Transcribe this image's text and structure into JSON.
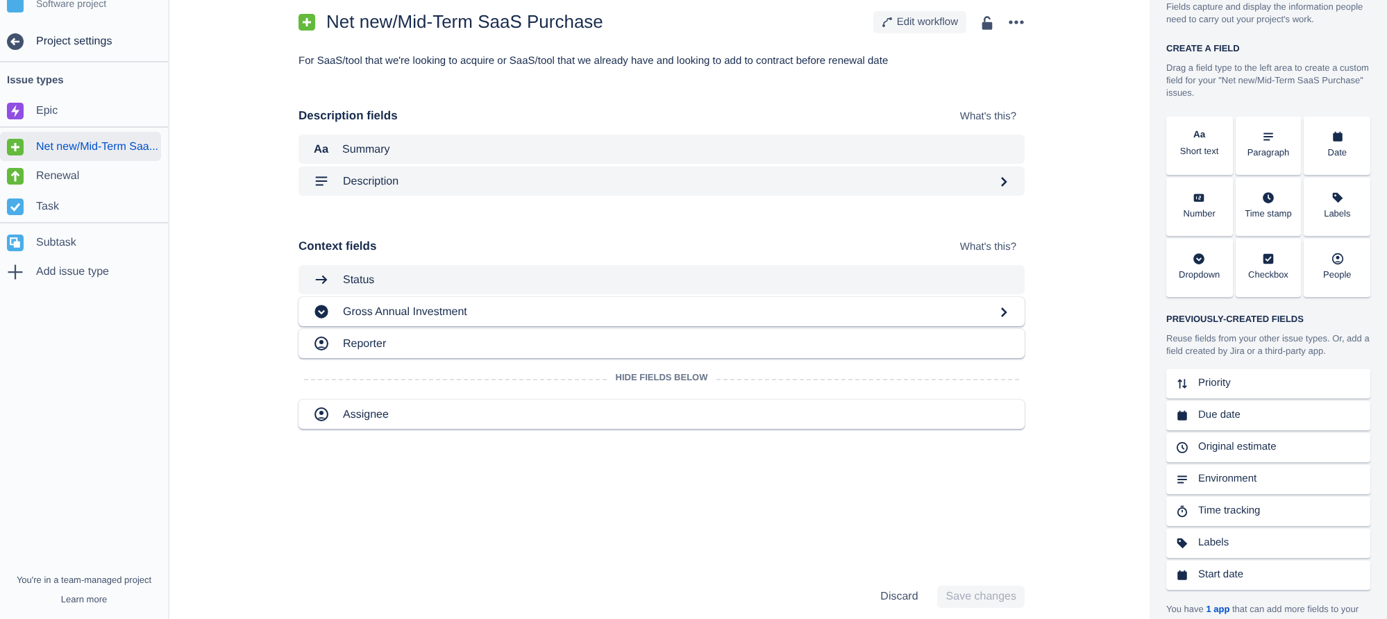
{
  "sidebar": {
    "project_type": "Software project",
    "settings_link": "Project settings",
    "section_title": "Issue types",
    "issue_types": [
      {
        "label": "Epic",
        "kind": "epic",
        "color": "#904ee2",
        "selected": false,
        "divider_after": true
      },
      {
        "label": "Net new/Mid-Term Saa...",
        "kind": "plus",
        "color": "#63ba3c",
        "selected": true,
        "divider_after": false
      },
      {
        "label": "Renewal",
        "kind": "up",
        "color": "#63ba3c",
        "selected": false,
        "divider_after": false
      },
      {
        "label": "Task",
        "kind": "check",
        "color": "#4bade8",
        "selected": false,
        "divider_after": true
      },
      {
        "label": "Subtask",
        "kind": "subtask",
        "color": "#4bade8",
        "selected": false,
        "divider_after": false
      }
    ],
    "add_label": "Add issue type",
    "footer_text": "You're in a team-managed project",
    "footer_link": "Learn more"
  },
  "main": {
    "title": "Net new/Mid-Term SaaS Purchase",
    "edit_workflow": "Edit workflow",
    "description": "For SaaS/tool that we're looking to acquire or SaaS/tool that we already have and looking to add to contract before renewal date",
    "sections": [
      {
        "title": "Description fields",
        "help": "What's this?",
        "fields": [
          {
            "label": "Summary",
            "kind": "text",
            "icon_text": "Aa",
            "locked": true,
            "chevron": false
          },
          {
            "label": "Description",
            "kind": "paragraph",
            "locked": true,
            "chevron": true
          }
        ]
      },
      {
        "title": "Context fields",
        "help": "What's this?",
        "fields": [
          {
            "label": "Status",
            "kind": "arrow",
            "locked": true,
            "chevron": false
          },
          {
            "label": "Gross Annual Investment",
            "kind": "dropdown",
            "locked": false,
            "chevron": true
          },
          {
            "label": "Reporter",
            "kind": "person",
            "locked": false,
            "chevron": false
          }
        ],
        "hide_label": "HIDE FIELDS BELOW",
        "hidden_fields": [
          {
            "label": "Assignee",
            "kind": "person",
            "locked": false,
            "chevron": false
          }
        ]
      }
    ],
    "discard": "Discard",
    "save": "Save changes",
    "save_disabled": true
  },
  "panel": {
    "intro": "Fields capture and display the information people need to carry out your project's work.",
    "create_title": "CREATE A FIELD",
    "create_text": "Drag a field type to the left area to create a custom field for your \"Net new/Mid-Term SaaS Purchase\" issues.",
    "field_types": [
      {
        "label": "Short text",
        "kind": "text",
        "icon_text": "Aa"
      },
      {
        "label": "Paragraph",
        "kind": "paragraph"
      },
      {
        "label": "Date",
        "kind": "date"
      },
      {
        "label": "Number",
        "kind": "number"
      },
      {
        "label": "Time stamp",
        "kind": "clock"
      },
      {
        "label": "Labels",
        "kind": "tag"
      },
      {
        "label": "Dropdown",
        "kind": "dropdown"
      },
      {
        "label": "Checkbox",
        "kind": "checkbox"
      },
      {
        "label": "People",
        "kind": "person"
      }
    ],
    "previous_title": "PREVIOUSLY-CREATED FIELDS",
    "previous_text": "Reuse fields from your other issue types. Or, add a field created by Jira or a third-party app.",
    "previous_fields": [
      {
        "label": "Priority",
        "kind": "priority"
      },
      {
        "label": "Due date",
        "kind": "date"
      },
      {
        "label": "Original estimate",
        "kind": "clockoutline"
      },
      {
        "label": "Environment",
        "kind": "paragraph"
      },
      {
        "label": "Time tracking",
        "kind": "stopwatch"
      },
      {
        "label": "Labels",
        "kind": "tag"
      },
      {
        "label": "Start date",
        "kind": "date"
      }
    ],
    "apps_prefix": "You have",
    "apps_link": "1 app",
    "apps_suffix": "that can add more fields to your"
  }
}
